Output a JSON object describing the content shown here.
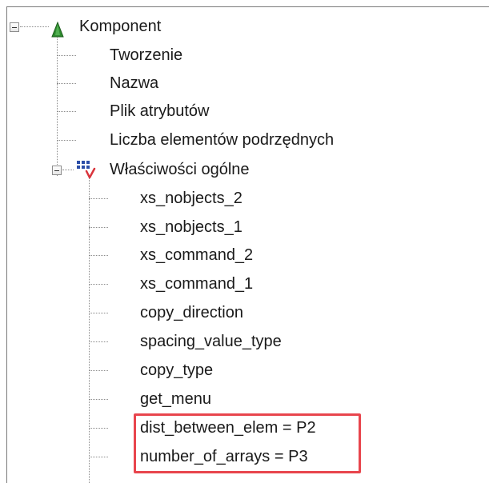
{
  "tree": {
    "root": {
      "label": "Komponent",
      "icon": "green-cone-icon",
      "expanded": true,
      "children": [
        {
          "label": "Tworzenie"
        },
        {
          "label": "Nazwa"
        },
        {
          "label": "Plik atrybutów"
        },
        {
          "label": "Liczba elementów podrzędnych"
        }
      ]
    },
    "group": {
      "label": "Właściwości ogólne",
      "icon": "properties-grid-icon",
      "expanded": true,
      "children": [
        {
          "label": "xs_nobjects_2"
        },
        {
          "label": "xs_nobjects_1"
        },
        {
          "label": "xs_command_2"
        },
        {
          "label": "xs_command_1"
        },
        {
          "label": "copy_direction"
        },
        {
          "label": "spacing_value_type"
        },
        {
          "label": "copy_type"
        },
        {
          "label": "get_menu"
        },
        {
          "label": "dist_between_elem = P2",
          "highlighted": true
        },
        {
          "label": "number_of_arrays = P3",
          "highlighted": true
        }
      ]
    }
  },
  "colors": {
    "highlight_border": "#e8454d",
    "tree_line": "#8a8a8a",
    "cone_icon": "#2e8b2e"
  }
}
